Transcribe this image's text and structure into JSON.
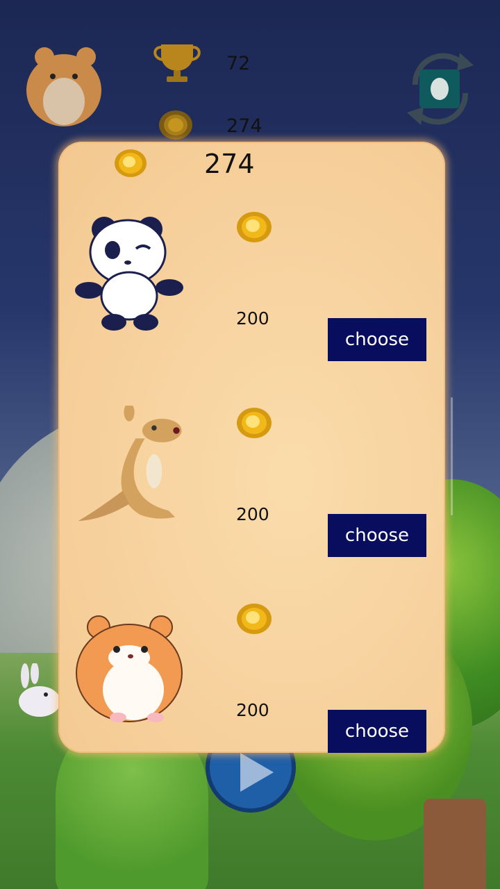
{
  "hud": {
    "score": "72",
    "coins": "274",
    "avatar_icon": "hamster-avatar-icon",
    "trophy_icon": "trophy-icon",
    "coin_icon": "gold-coin-icon",
    "camera_icon": "switch-camera-icon"
  },
  "shop": {
    "balance": "274",
    "items": [
      {
        "animal": "panda",
        "price": "200",
        "button_label": "choose"
      },
      {
        "animal": "kangaroo",
        "price": "200",
        "button_label": "choose"
      },
      {
        "animal": "hamster",
        "price": "200",
        "button_label": "choose"
      }
    ]
  },
  "colors": {
    "button_bg": "#090d5e",
    "panel_bg": "#f7d3a0",
    "coin_gold": "#f2b81a"
  }
}
